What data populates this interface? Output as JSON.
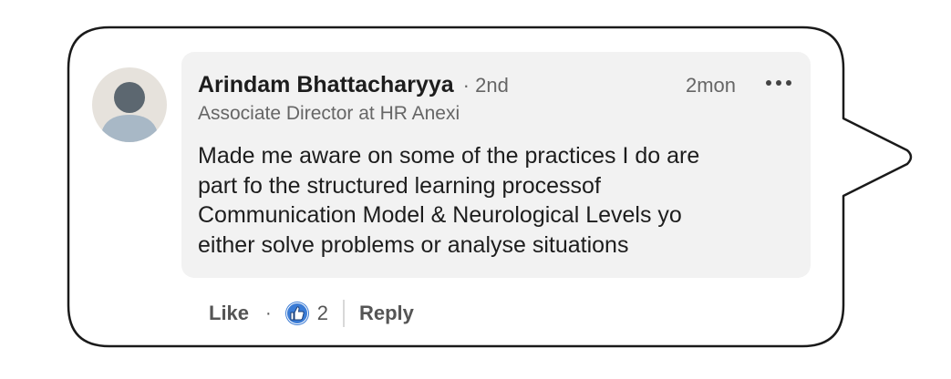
{
  "comment": {
    "author_name": "Arindam Bhattacharyya",
    "connection_degree": "· 2nd",
    "timestamp": "2mon",
    "more_icon": "ellipsis-icon",
    "headline": "Associate Director at HR Anexi",
    "text_lines": [
      "Made me aware on some of the practices I do are",
      "part fo the structured learning processof",
      "Communication Model & Neurological Levels yo",
      "either solve problems or analyse situations"
    ]
  },
  "actions": {
    "like_label": "Like",
    "separator": "·",
    "reaction_icon": "thumbs-up-icon",
    "reaction_count": "2",
    "reply_label": "Reply"
  },
  "colors": {
    "background": "#ffffff",
    "comment_box": "#f2f2f2",
    "reaction_blue": "#3a7bd5",
    "text_primary": "#1d1d1d",
    "text_secondary": "#666666"
  }
}
